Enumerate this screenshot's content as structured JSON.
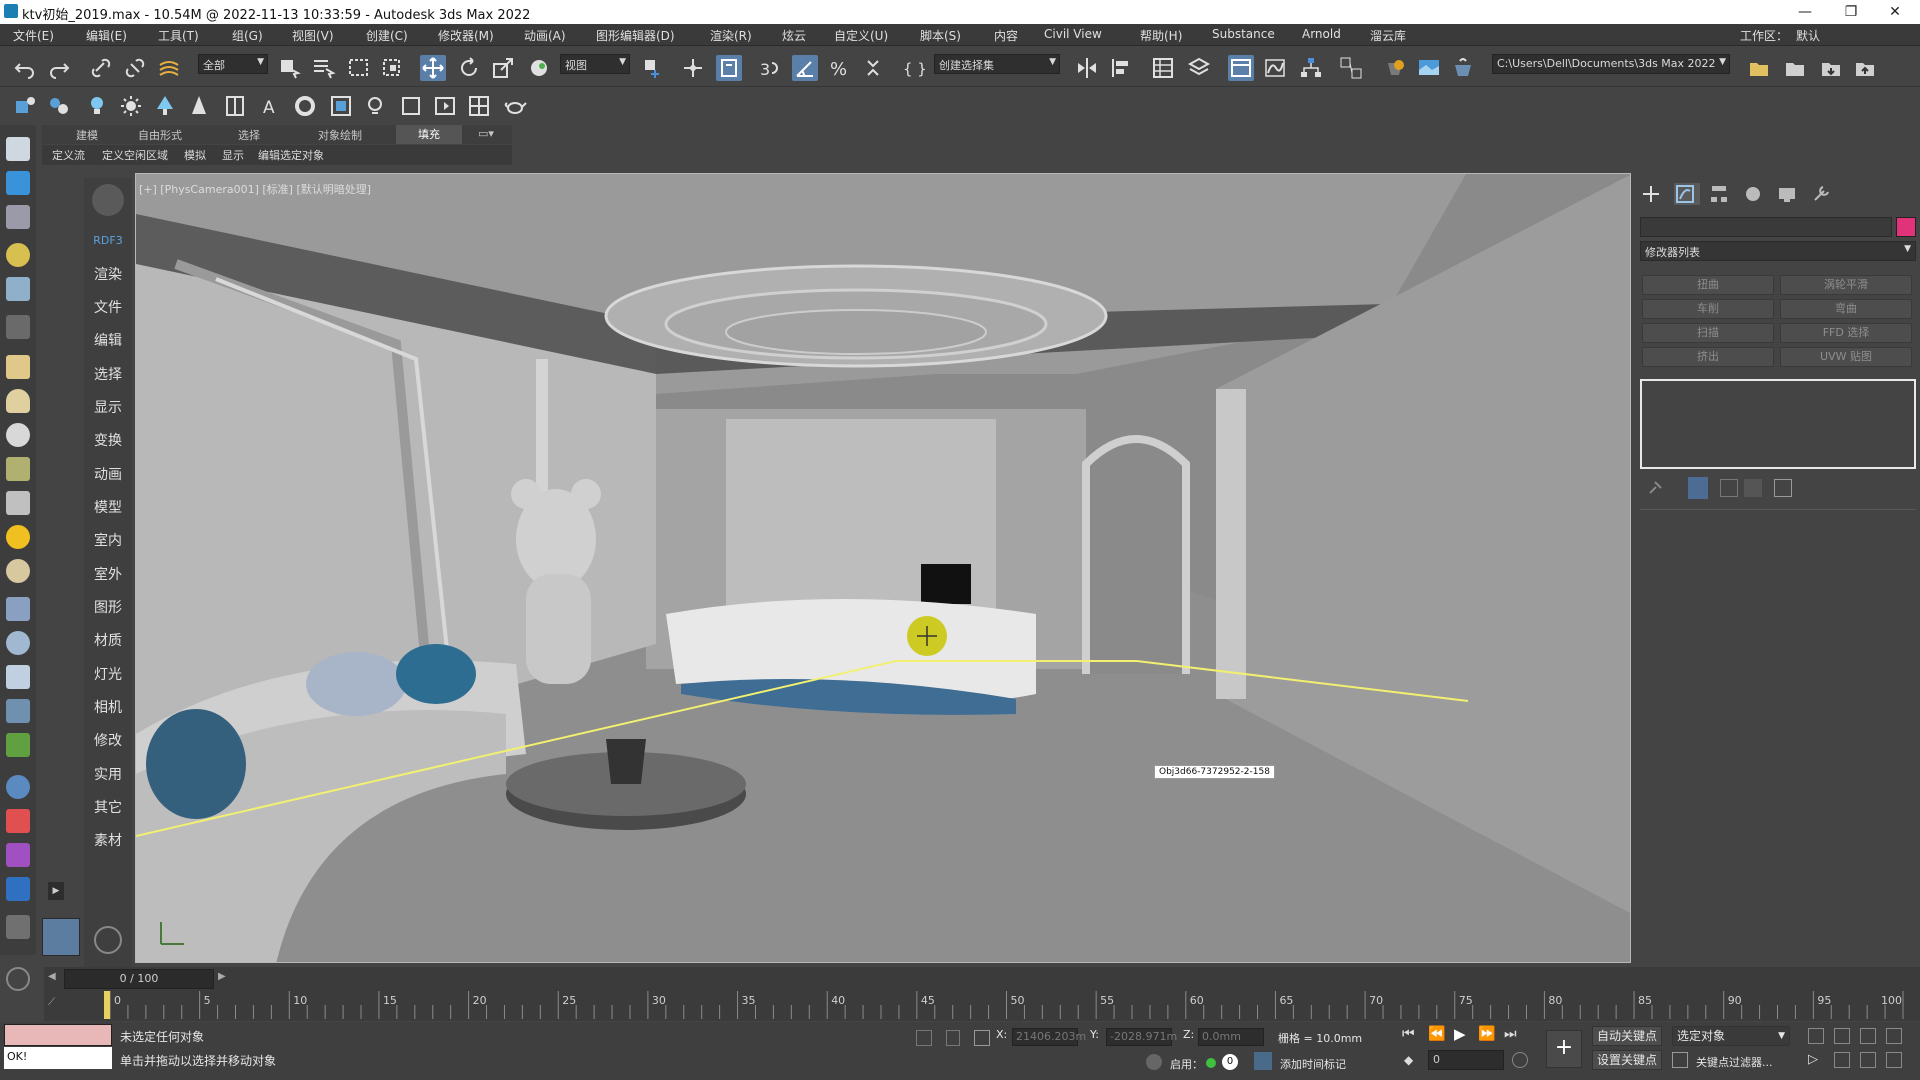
{
  "titlebar": {
    "title": "ktv初始_2019.max - 10.54M @ 2022-11-13 10:33:59 - Autodesk 3ds Max 2022",
    "minimize": "—",
    "restore": "❐",
    "close": "✕"
  },
  "menubar": {
    "items": [
      "文件(E)",
      "编辑(E)",
      "工具(T)",
      "组(G)",
      "视图(V)",
      "创建(C)",
      "修改器(M)",
      "动画(A)",
      "图形编辑器(D)",
      "渲染(R)",
      "炫云",
      "自定义(U)",
      "脚本(S)",
      "内容",
      "Civil View",
      "帮助(H)",
      "Substance",
      "Arnold",
      "溜云库"
    ],
    "workspace_label": "工作区：",
    "workspace_value": "默认"
  },
  "toolbar1": {
    "selection_filter": "全部",
    "ref_coord": "视图",
    "named_selection": "创建选择集",
    "project_path": "C:\\Users\\Dell\\Documents\\3ds Max 2022"
  },
  "ribbon": {
    "tabs": [
      "建模",
      "自由形式",
      "选择",
      "对象绘制",
      "填充"
    ],
    "active_tab": "填充",
    "sub_items": [
      "定义流",
      "定义空闲区域",
      "模拟",
      "显示",
      "编辑选定对象"
    ]
  },
  "dock": {
    "header": "RDF3",
    "items": [
      "渲染",
      "文件",
      "编辑",
      "选择",
      "显示",
      "变换",
      "动画",
      "模型",
      "室内",
      "室外",
      "图形",
      "材质",
      "灯光",
      "相机",
      "修改",
      "实用",
      "其它",
      "素材"
    ]
  },
  "viewport": {
    "label": "[+] [PhysCamera001] [标准] [默认明暗处理]",
    "tooltip": "Obj3d66-7372952-2-158",
    "colors": {
      "ceiling": "#5f5f5f",
      "floor": "#8c8c8c",
      "wall": "#c8c8c8",
      "guide_line": "#f2f070",
      "cursor": "#c8c400",
      "accent_blue": "#3f6d94"
    }
  },
  "cmdpanel": {
    "modifier_list": "修改器列表",
    "buttons": [
      "扭曲",
      "涡轮平滑",
      "车削",
      "弯曲",
      "扫描",
      "FFD 选择",
      "挤出",
      "UVW 贴图"
    ],
    "color_swatch": "#e0337a"
  },
  "timeline": {
    "slider": "0 / 100",
    "ticks": [
      "0",
      "5",
      "10",
      "15",
      "20",
      "25",
      "30",
      "35",
      "40",
      "45",
      "50",
      "55",
      "60",
      "65",
      "70",
      "75",
      "80",
      "85",
      "90",
      "95",
      "100"
    ]
  },
  "statusbar": {
    "selection_status": "未选定任何对象",
    "prompt": "单击并拖动以选择并移动对象",
    "maxscript": "OK!",
    "x_label": "X:",
    "x_value": "21406.203m",
    "y_label": "Y:",
    "y_value": "-2028.971m",
    "z_label": "Z:",
    "z_value": "0.0mm",
    "grid": "栅格 = 10.0mm",
    "enable": "启用：",
    "enable_value": "0",
    "add_time_tag": "添加时间标记",
    "auto_key": "自动关键点",
    "set_key": "设置关键点",
    "selected_dropdown": "选定对象",
    "key_filters": "关键点过滤器...",
    "frame_value": "0"
  }
}
